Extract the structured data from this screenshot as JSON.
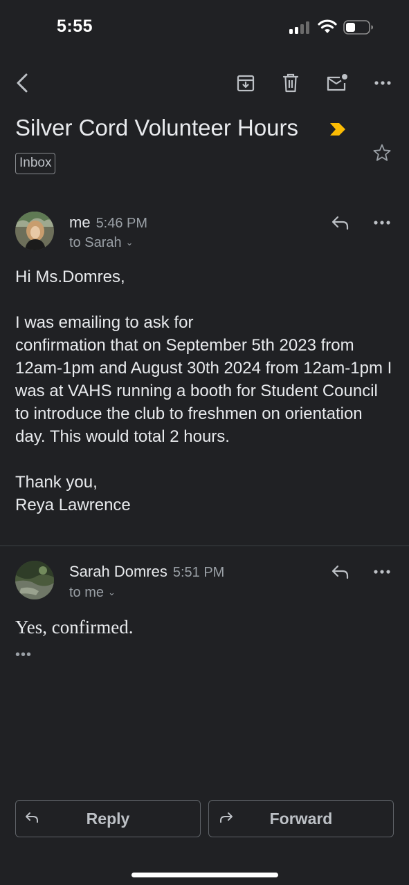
{
  "status_bar": {
    "time": "5:55"
  },
  "toolbar": {
    "icons": [
      "back-arrow-icon",
      "archive-icon",
      "trash-icon",
      "mark-unread-icon",
      "more-horizontal-icon"
    ]
  },
  "thread": {
    "subject": "Silver Cord Volunteer Hours",
    "label": "Inbox",
    "importance_color": "#fbbc04"
  },
  "messages": [
    {
      "sender": "me",
      "time": "5:46 PM",
      "recipient": "to Sarah",
      "body": [
        "Hi Ms.Domres,",
        "I was emailing to ask for\nconfirmation that on September 5th 2023 from 12am-1pm and August 30th 2024 from 12am-1pm I was at VAHS running a booth for Student Council to introduce the club to freshmen on orientation day. This would total 2 hours.",
        "Thank you,\nReya Lawrence"
      ]
    },
    {
      "sender": "Sarah Domres",
      "time": "5:51 PM",
      "recipient": "to me",
      "body": "Yes, confirmed.",
      "trimmed_content": "•••"
    }
  ],
  "actions": {
    "reply_label": "Reply",
    "forward_label": "Forward"
  },
  "colors": {
    "background": "#202124",
    "text": "#e8eaed",
    "secondary_text": "#9aa0a6"
  }
}
